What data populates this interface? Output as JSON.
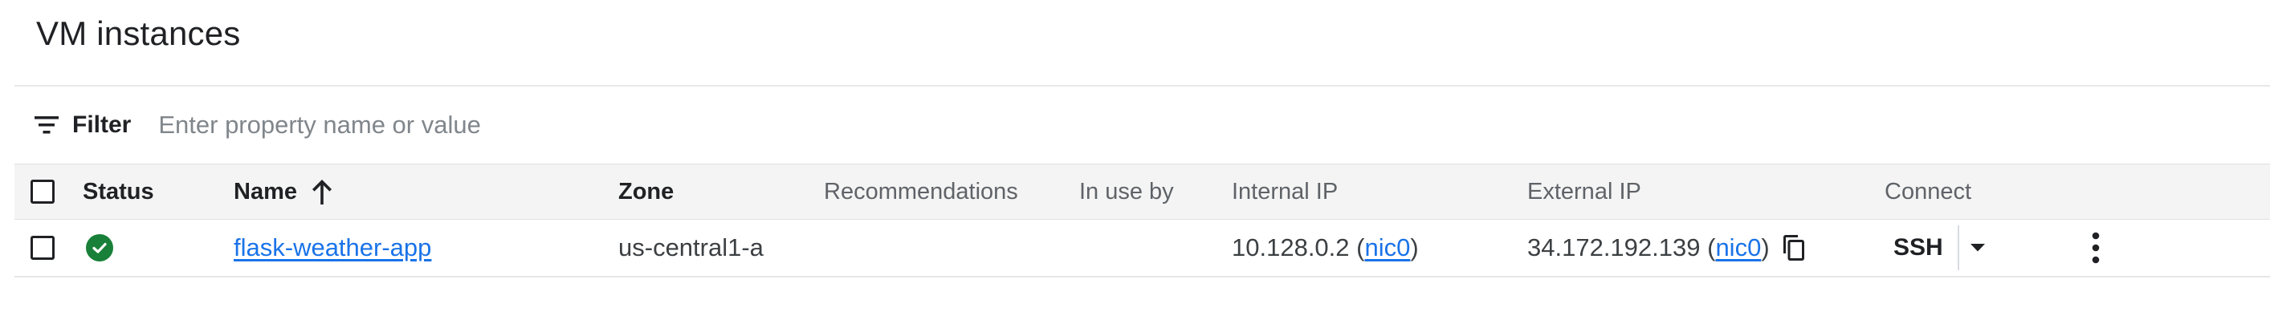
{
  "page": {
    "title": "VM instances"
  },
  "filter": {
    "label": "Filter",
    "placeholder": "Enter property name or value",
    "icon": "filter-list-icon"
  },
  "table": {
    "columns": {
      "status": "Status",
      "name": "Name",
      "zone": "Zone",
      "recommendations": "Recommendations",
      "in_use_by": "In use by",
      "internal_ip": "Internal IP",
      "external_ip": "External IP",
      "connect": "Connect"
    },
    "sort": {
      "column": "name",
      "direction": "ascending",
      "icon": "arrow-up-icon"
    },
    "rows": [
      {
        "selected": false,
        "status": "running",
        "status_icon": "check-circle-icon",
        "name": "flask-weather-app",
        "zone": "us-central1-a",
        "recommendations": "",
        "in_use_by": "",
        "internal_ip": {
          "address": "10.128.0.2",
          "nic": "nic0"
        },
        "external_ip": {
          "address": "34.172.192.139",
          "nic": "nic0",
          "copy_icon": "copy-icon"
        },
        "connect": {
          "ssh_label": "SSH",
          "dropdown_icon": "arrow-drop-down-icon",
          "more_icon": "more-vert-icon"
        }
      }
    ]
  },
  "colors": {
    "link": "#1a73e8",
    "status_ok": "#188038",
    "header_bg": "#f4f4f4"
  }
}
